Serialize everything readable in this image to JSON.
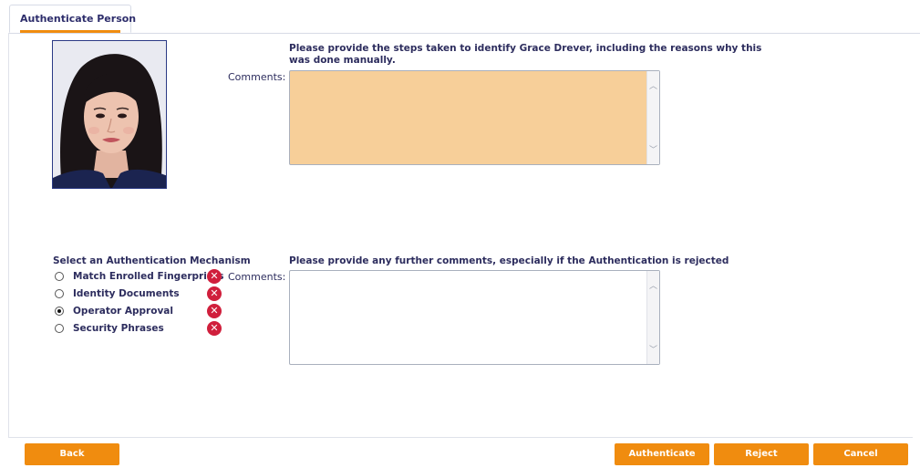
{
  "tab": {
    "label": "Authenticate Person"
  },
  "person": {
    "name": "Grace Drever"
  },
  "manual_section": {
    "instruction_line1": "Please provide the steps taken to identify Grace Drever, including the reasons why this",
    "instruction_line2": "was done manually.",
    "comments_label": "Comments:",
    "value": ""
  },
  "mechanism": {
    "title": "Select an Authentication Mechanism",
    "options": [
      {
        "label": "Match Enrolled Fingerprints",
        "selected": false,
        "status_icon": "x-circle-icon"
      },
      {
        "label": "Identity Documents",
        "selected": false,
        "status_icon": "x-circle-icon"
      },
      {
        "label": "Operator Approval",
        "selected": true,
        "status_icon": "x-circle-icon"
      },
      {
        "label": "Security Phrases",
        "selected": false,
        "status_icon": "x-circle-icon"
      }
    ]
  },
  "further_section": {
    "instruction": "Please provide any further comments, especially if the Authentication is rejected",
    "comments_label": "Comments:",
    "value": ""
  },
  "buttons": {
    "back": "Back",
    "authenticate": "Authenticate",
    "reject": "Reject",
    "cancel": "Cancel"
  },
  "colors": {
    "accent": "#f08c0f",
    "filled_field": "#f7cf99",
    "error": "#d01f3c",
    "text": "#2d2d5e"
  }
}
